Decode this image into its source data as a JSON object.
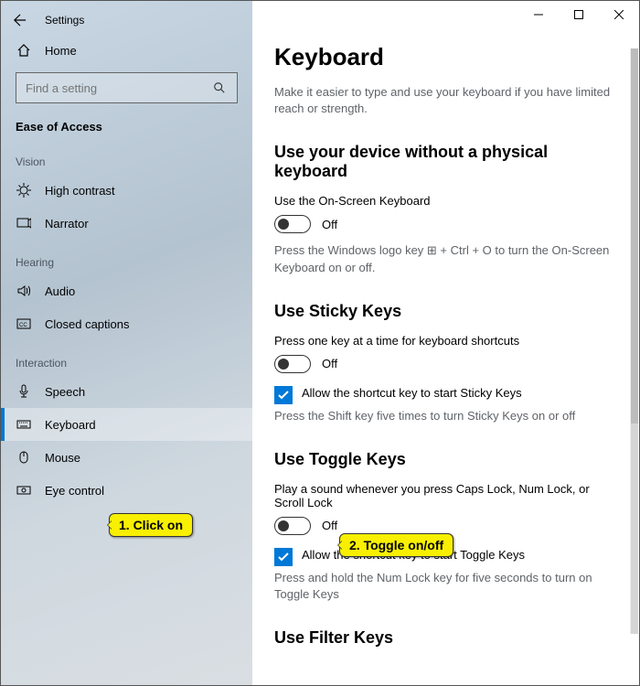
{
  "window": {
    "title": "Settings"
  },
  "sidebar": {
    "home": "Home",
    "search_placeholder": "Find a setting",
    "section": "Ease of Access",
    "groups": {
      "vision": {
        "label": "Vision",
        "items": [
          "High contrast",
          "Narrator"
        ]
      },
      "hearing": {
        "label": "Hearing",
        "items": [
          "Audio",
          "Closed captions"
        ]
      },
      "interaction": {
        "label": "Interaction",
        "items": [
          "Speech",
          "Keyboard",
          "Mouse",
          "Eye control"
        ]
      }
    }
  },
  "page": {
    "title": "Keyboard",
    "intro": "Make it easier to type and use your keyboard if you have limited reach or strength.",
    "sec1": {
      "heading": "Use your device without a physical keyboard",
      "toggle_label": "Use the On-Screen Keyboard",
      "toggle_state": "Off",
      "hint": "Press the Windows logo key ⊞ + Ctrl + O to turn the On-Screen Keyboard on or off."
    },
    "sec2": {
      "heading": "Use Sticky Keys",
      "toggle_label": "Press one key at a time for keyboard shortcuts",
      "toggle_state": "Off",
      "check_label": "Allow the shortcut key to start Sticky Keys",
      "hint": "Press the Shift key five times to turn Sticky Keys on or off"
    },
    "sec3": {
      "heading": "Use Toggle Keys",
      "toggle_label": "Play a sound whenever you press Caps Lock, Num Lock, or Scroll Lock",
      "toggle_state": "Off",
      "check_label": "Allow the shortcut key to start Toggle Keys",
      "hint": "Press and hold the Num Lock key for five seconds to turn on Toggle Keys"
    },
    "sec4": {
      "heading": "Use Filter Keys"
    }
  },
  "annotations": {
    "a1": "1. Click on",
    "a2": "2. Toggle on/off"
  }
}
